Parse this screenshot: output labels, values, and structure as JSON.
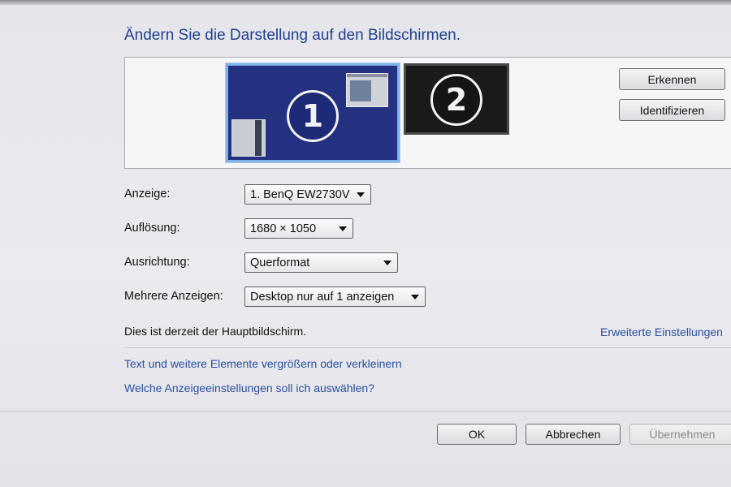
{
  "heading": "Ändern Sie die Darstellung auf den Bildschirmen.",
  "monitors": {
    "monitor1_number": "1",
    "monitor2_number": "2"
  },
  "buttons": {
    "detect": "Erkennen",
    "identify": "Identifizieren",
    "ok": "OK",
    "cancel": "Abbrechen",
    "apply": "Übernehmen"
  },
  "settings": {
    "display_label": "Anzeige:",
    "display_value": "1. BenQ EW2730V",
    "resolution_label": "Auflösung:",
    "resolution_value": "1680 × 1050",
    "orientation_label": "Ausrichtung:",
    "orientation_value": "Querformat",
    "multiple_label": "Mehrere Anzeigen:",
    "multiple_value": "Desktop nur auf 1 anzeigen"
  },
  "info": {
    "primary_text": "Dies ist derzeit der Hauptbildschirm.",
    "advanced_link": "Erweiterte Einstellungen"
  },
  "links": {
    "text_size": "Text und weitere Elemente vergrößern oder verkleinern",
    "which_settings": "Welche Anzeigeeinstellungen soll ich auswählen?"
  },
  "colors": {
    "heading": "#1f3f8f",
    "link": "#2a4f9e",
    "monitor1_bg": "#243080",
    "monitor1_selection": "#7fb2ea",
    "monitor2_bg": "#1a1a1a"
  }
}
